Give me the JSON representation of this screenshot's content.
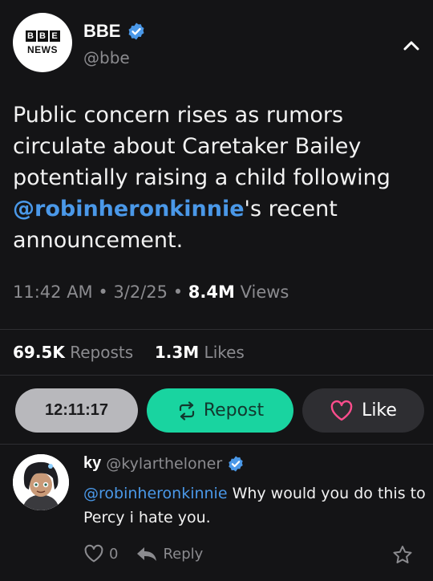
{
  "header": {
    "logo_letters": [
      "B",
      "B",
      "E"
    ],
    "logo_word": "NEWS",
    "display_name": "BBE",
    "handle": "@bbe"
  },
  "tweet": {
    "text_before": "Public concern rises as rumors circulate about Caretaker Bailey potentially raising a child following ",
    "mention": "@robinheronkinnie",
    "text_after": "'s recent announcement.",
    "time": "11:42 AM",
    "date": "3/2/25",
    "views_count": "8.4M",
    "views_label": "Views",
    "reposts_count": "69.5K",
    "reposts_label": "Reposts",
    "likes_count": "1.3M",
    "likes_label": "Likes"
  },
  "actions": {
    "timer_label": "12:11:17",
    "repost_label": "Repost",
    "like_label": "Like"
  },
  "reply": {
    "name": "ky",
    "handle": "@kylartheloner",
    "mention": "@robinheronkinnie",
    "text": " Why would you do this to Percy i hate you.",
    "like_count": "0",
    "reply_label": "Reply"
  },
  "colors": {
    "background": "#141416",
    "accent_blue": "#4a98e8",
    "repost_green": "#19d4a0",
    "like_pink": "#ff4d8d",
    "muted": "#8b8b8f"
  },
  "icons": [
    "verified-badge-icon",
    "chevron-up-icon",
    "repost-icon",
    "heart-icon",
    "reply-arrow-icon",
    "star-icon"
  ]
}
